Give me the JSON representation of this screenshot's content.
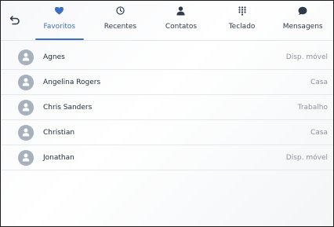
{
  "tabs": [
    {
      "label": "Favoritos",
      "icon": "heart-icon",
      "active": true
    },
    {
      "label": "Recentes",
      "icon": "clock-icon",
      "active": false
    },
    {
      "label": "Contatos",
      "icon": "person-icon",
      "active": false
    },
    {
      "label": "Teclado",
      "icon": "dialpad-icon",
      "active": false
    },
    {
      "label": "Mensagens",
      "icon": "message-bubble-icon",
      "active": false
    }
  ],
  "contacts": [
    {
      "name": "Agnes",
      "type": "Disp. móvel"
    },
    {
      "name": "Angelina Rogers",
      "type": "Casa"
    },
    {
      "name": "Chris Sanders",
      "type": "Trabalho"
    },
    {
      "name": "Christian",
      "type": "Casa"
    },
    {
      "name": "Jonathan",
      "type": "Disp. móvel"
    }
  ],
  "colors": {
    "accent": "#3a6fc4",
    "avatar": "#a7b0bd",
    "text": "#1f2933",
    "secondary_text": "#8c939c"
  }
}
